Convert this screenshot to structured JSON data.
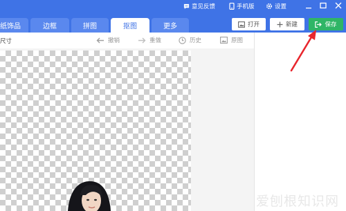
{
  "top_links": {
    "feedback": "意见反馈",
    "mobile": "手机版",
    "settings": "设置"
  },
  "tabs": [
    {
      "label": "纸饰品",
      "active": false
    },
    {
      "label": "边框",
      "active": false
    },
    {
      "label": "拼图",
      "active": false
    },
    {
      "label": "抠图",
      "active": true
    },
    {
      "label": "更多",
      "active": false
    }
  ],
  "actions": {
    "open": "打开",
    "new": "新建",
    "save": "保存"
  },
  "toolbar": {
    "size_label": "尺寸",
    "undo": "撤销",
    "redo": "重做",
    "history": "历史",
    "original": "原图"
  },
  "watermark": "爱刨根知识网",
  "colors": {
    "header_blue": "#3f73e6",
    "save_green": "#2fb566",
    "arrow_red": "#e8262d"
  }
}
